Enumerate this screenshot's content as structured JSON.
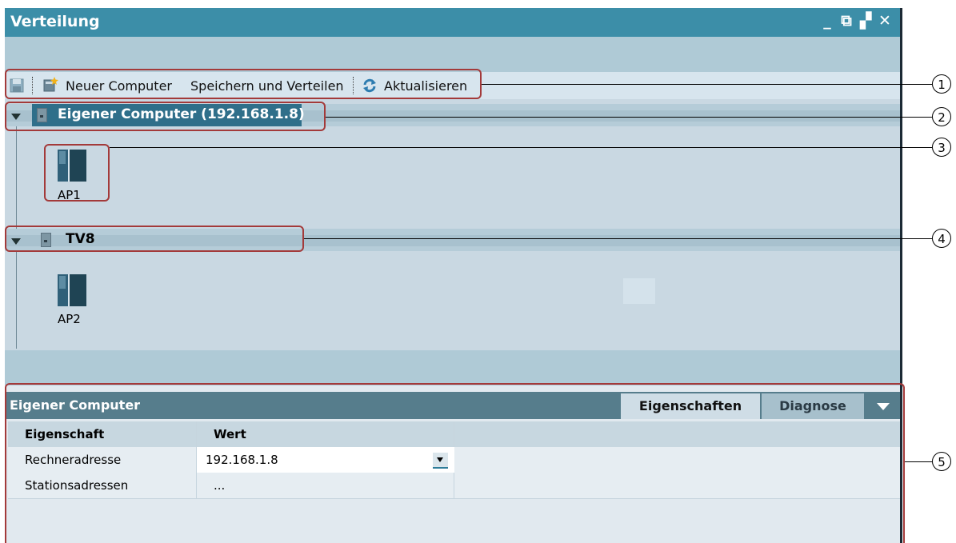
{
  "window": {
    "title": "Verteilung",
    "controls": {
      "minimize": "_",
      "detach": "⧉",
      "restore": "▞",
      "close": "✕"
    }
  },
  "toolbar": {
    "new_computer": "Neuer Computer",
    "save_distribute": "Speichern und Verteilen",
    "refresh": "Aktualisieren"
  },
  "tree": {
    "groups": [
      {
        "label": "Eigener Computer (192.168.1.8)",
        "items": [
          {
            "label": "AP1"
          }
        ]
      },
      {
        "label": "TV8",
        "items": [
          {
            "label": "AP2"
          }
        ]
      }
    ]
  },
  "panel": {
    "title": "Eigener Computer",
    "tabs": [
      "Eigenschaften",
      "Diagnose"
    ],
    "table": {
      "headers": [
        "Eigenschaft",
        "Wert"
      ],
      "rows": [
        {
          "property": "Rechneradresse",
          "value": "192.168.1.8"
        },
        {
          "property": "Stationsadressen",
          "value": "..."
        }
      ]
    }
  },
  "callouts": [
    "1",
    "2",
    "3",
    "4",
    "5"
  ],
  "colors": {
    "titlebar": "#3c8ea8",
    "callout_border": "#a33a3a",
    "panel_header": "#567d8c"
  }
}
